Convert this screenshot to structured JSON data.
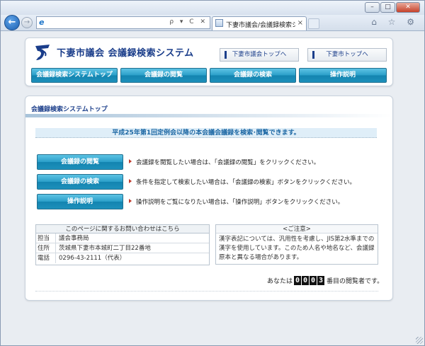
{
  "browser": {
    "address_value": "",
    "address_tools": "ρ ▾ C ✕",
    "tab_title": "下妻市議会/会議録検索シ...",
    "tab_close": "×",
    "window_controls": {
      "minimize": "–",
      "maximize": "□",
      "close": "✕"
    },
    "back": "←",
    "forward": "→",
    "toolbar_icons": "⌂ ☆ ⚙"
  },
  "header": {
    "site_title": "下妻市議会  会議録検索システム",
    "link_council_top": "下妻市議会トップへ",
    "link_city_top": "下妻市トップへ",
    "nav": [
      {
        "label": "会議録検索システムトップ"
      },
      {
        "label": "会議録の閲覧"
      },
      {
        "label": "会議録の検索"
      },
      {
        "label": "操作説明"
      }
    ]
  },
  "main": {
    "section_title": "会議録検索システムトップ",
    "banner": "平成25年第1回定例会以降の本会議会議録を検索･閲覧できます。",
    "actions": [
      {
        "button": "会議録の閲覧",
        "description": "会議録を閲覧したい場合は、「会議録の閲覧」をクリックください。"
      },
      {
        "button": "会議録の検索",
        "description": "条件を指定して検索したい場合は、「会議録の検索」ボタンをクリックください。"
      },
      {
        "button": "操作説明",
        "description": "操作説明をご覧になりたい場合は、「操作説明」ボタンをクリックください。"
      }
    ],
    "contact": {
      "heading": "このページに関するお問い合わせはこちら",
      "rows": [
        {
          "key": "担当",
          "value": "議会事務局"
        },
        {
          "key": "住所",
          "value": "茨城県下妻市本城町二丁目22番地"
        },
        {
          "key": "電話",
          "value": "0296-43-2111（代表）"
        }
      ]
    },
    "notice": {
      "heading": "<ご注意>",
      "body": "漢字表記については、汎用性を考慮し、JIS第2水準までの漢字を使用しています。このため人名や地名など、会議録原本と異なる場合があります。"
    },
    "counter": {
      "prefix": "あなたは",
      "digits": [
        "0",
        "0",
        "0",
        "3"
      ],
      "suffix": "番目の閲覧者です。"
    }
  },
  "colors": {
    "accent": "#1c3f8b",
    "button_top": "#5dc3e4",
    "button_bottom": "#1384b0",
    "banner_bg": "#dfeef8"
  }
}
